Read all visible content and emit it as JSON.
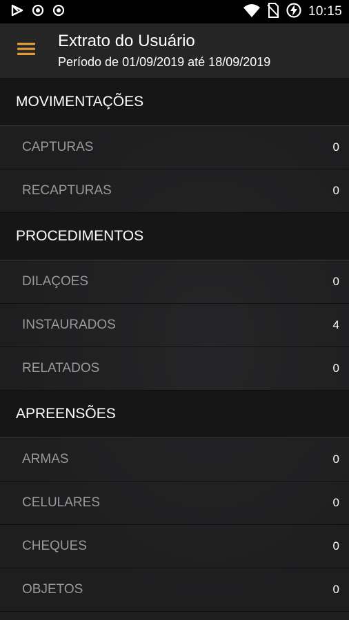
{
  "status_bar": {
    "time": "10:15",
    "left_icons": [
      "play-store-icon",
      "circle-dot-icon",
      "circle-dot-icon"
    ],
    "right_icons": [
      "wifi-icon",
      "no-sim-icon",
      "battery-charging-icon"
    ]
  },
  "header": {
    "title": "Extrato do Usuário",
    "subtitle": "Período de 01/09/2019 até 18/09/2019",
    "menu_icon": "hamburger-menu-icon",
    "accent_color": "#e59a3a"
  },
  "sections": [
    {
      "title": "MOVIMENTAÇÕES",
      "items": [
        {
          "label": "CAPTURAS",
          "value": "0"
        },
        {
          "label": "RECAPTURAS",
          "value": "0"
        }
      ]
    },
    {
      "title": "PROCEDIMENTOS",
      "items": [
        {
          "label": "DILAÇOES",
          "value": "0"
        },
        {
          "label": "INSTAURADOS",
          "value": "4"
        },
        {
          "label": "RELATADOS",
          "value": "0"
        }
      ]
    },
    {
      "title": "APREENSÕES",
      "items": [
        {
          "label": "ARMAS",
          "value": "0"
        },
        {
          "label": "CELULARES",
          "value": "0"
        },
        {
          "label": "CHEQUES",
          "value": "0"
        },
        {
          "label": "OBJETOS",
          "value": "0"
        }
      ]
    }
  ]
}
